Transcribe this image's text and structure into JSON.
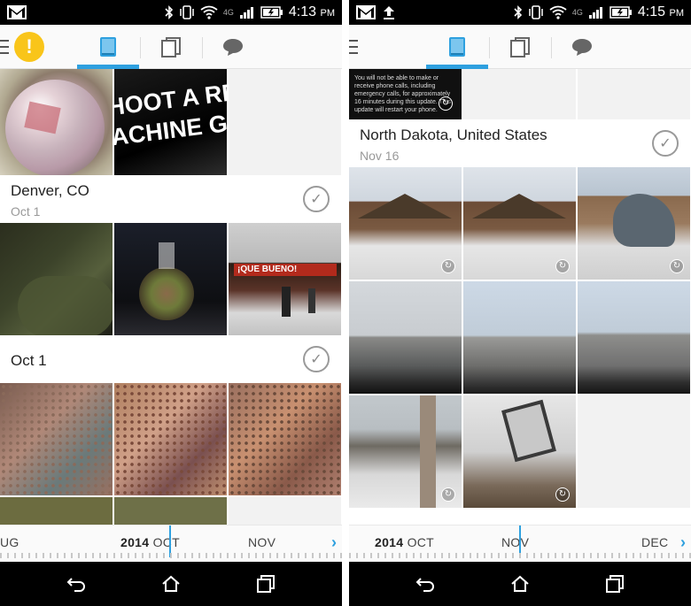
{
  "left": {
    "status": {
      "time": "4:13",
      "ampm": "PM",
      "network": "4G"
    },
    "sections": [
      {
        "title": "Denver, CO",
        "date": "Oct 1"
      },
      {
        "title": "Oct 1",
        "date": ""
      }
    ],
    "photo_text": "HOOT A REAL\nACHINE GUN!",
    "sign_text": "¡QUE BUENO!",
    "timeline": {
      "year": "2014",
      "month1": "OCT",
      "prev": "UG",
      "month2": "NOV",
      "chevron": "›"
    }
  },
  "right": {
    "status": {
      "time": "4:15",
      "ampm": "PM",
      "network": "4G"
    },
    "notice_text": "You will not be able to make or receive phone calls, including emergency calls, for approximately 16 minutes during this update. This update will restart your phone.",
    "sections": [
      {
        "title": "North Dakota, United States",
        "date": "Nov 16"
      }
    ],
    "timeline": {
      "year": "2014",
      "month1": "OCT",
      "month2": "NOV",
      "month3": "DEC",
      "chevron": "›"
    }
  },
  "icons": [
    "gmail-icon",
    "bluetooth-icon",
    "vibrate-icon",
    "wifi-icon",
    "signal-icon",
    "battery-icon",
    "upload-icon",
    "back-icon",
    "home-icon",
    "recents-icon",
    "phone-tab-icon",
    "cards-tab-icon",
    "chat-tab-icon",
    "menu-icon",
    "alert-icon",
    "check-icon",
    "sync-icon"
  ],
  "colors": {
    "accent": "#2ea0df",
    "alert": "#f9c51a"
  }
}
